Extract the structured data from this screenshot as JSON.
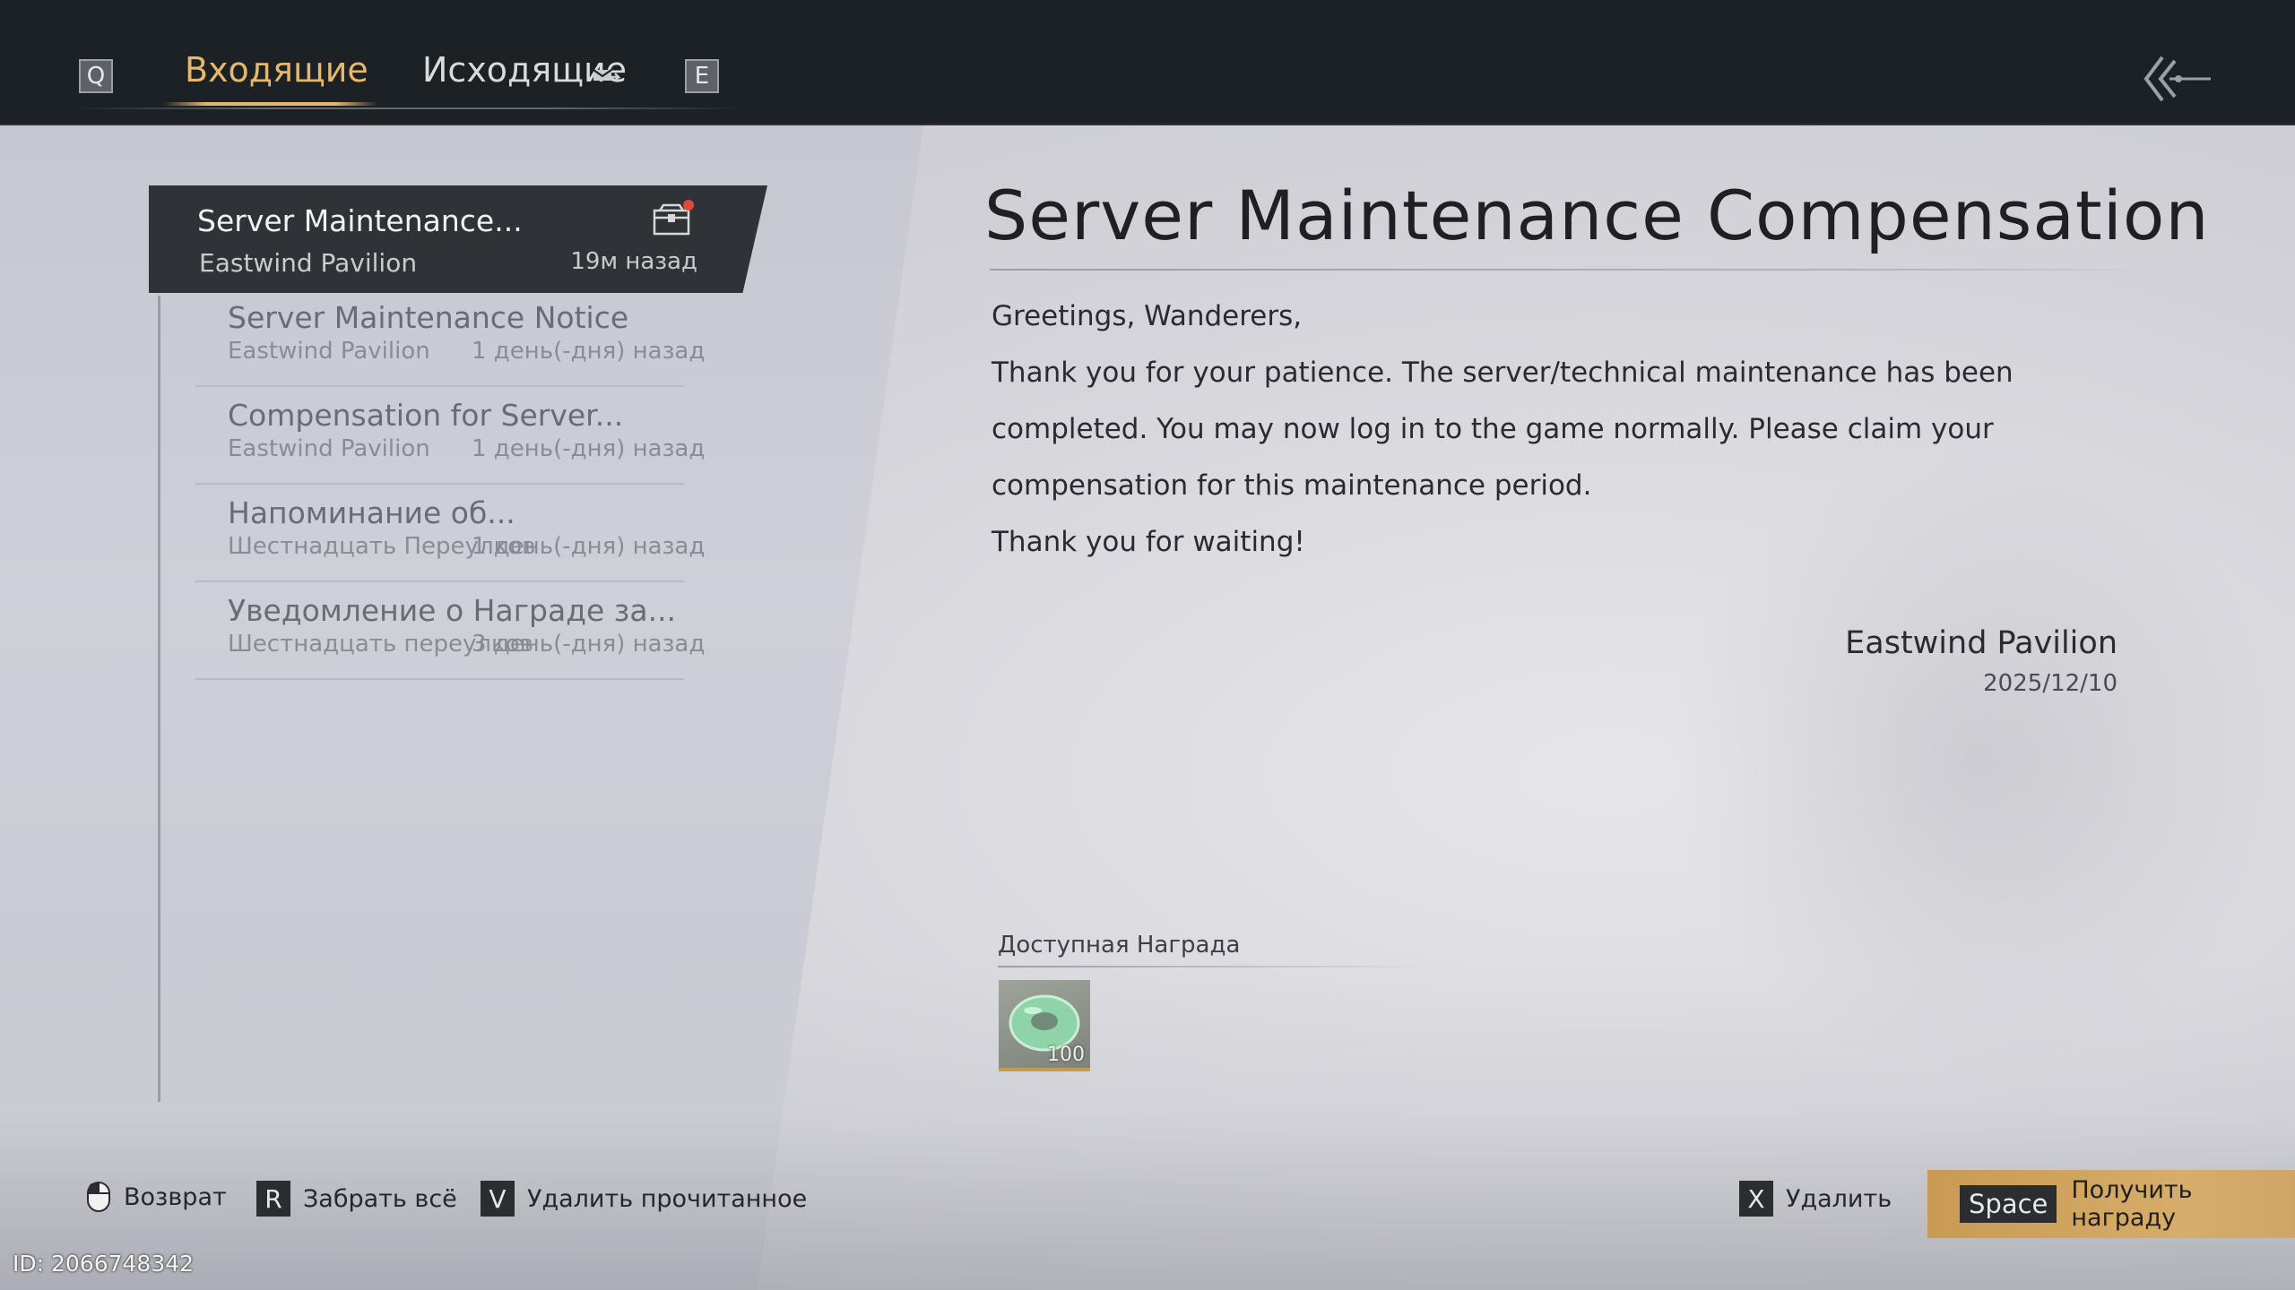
{
  "topbar": {
    "key_prev": "Q",
    "key_next": "E",
    "tab_inbox": "Входящие",
    "tab_outbox": "Исходящие"
  },
  "mail_list": [
    {
      "subject": "Server Maintenance...",
      "sender": "Eastwind Pavilion",
      "time": "19м назад",
      "selected": true,
      "has_attachment": true
    },
    {
      "subject": "Server Maintenance Notice",
      "sender": "Eastwind Pavilion",
      "time": "1 день(-дня) назад",
      "selected": false
    },
    {
      "subject": "Compensation for Server...",
      "sender": "Eastwind Pavilion",
      "time": "1 день(-дня) назад",
      "selected": false
    },
    {
      "subject": "Напоминание об...",
      "sender": "Шестнадцать Переулков",
      "time": "1 день(-дня) назад",
      "selected": false
    },
    {
      "subject": "Уведомление о Награде за...",
      "sender": "Шестнадцать переулков",
      "time": "3 день(-дня) назад",
      "selected": false
    }
  ],
  "detail": {
    "title": "Server Maintenance Compensation",
    "greeting": "Greetings, Wanderers,",
    "paragraph": "Thank you for your patience. The server/technical maintenance has been completed. You may now log in to the game normally. Please claim your compensation for this maintenance period.",
    "closing": "Thank you for waiting!",
    "signature": "Eastwind Pavilion",
    "date": "2025/12/10"
  },
  "reward": {
    "label": "Доступная Награда",
    "items": [
      {
        "icon": "jade-ring-icon",
        "quantity": "100"
      }
    ]
  },
  "bottom_bar": {
    "back_label": "Возврат",
    "claim_all_key": "R",
    "claim_all_label": "Забрать всё",
    "delete_read_key": "V",
    "delete_read_label": "Удалить прочитанное",
    "delete_key": "X",
    "delete_label": "Удалить",
    "claim_key": "Space",
    "claim_label": "Получить награду"
  },
  "uid": "ID: 2066748342",
  "colors": {
    "accent_gold": "#e6b86c",
    "topbar_bg": "#1c2125",
    "claim_button": "#d6ad6a",
    "selected_item_bg": "#2f3236"
  }
}
